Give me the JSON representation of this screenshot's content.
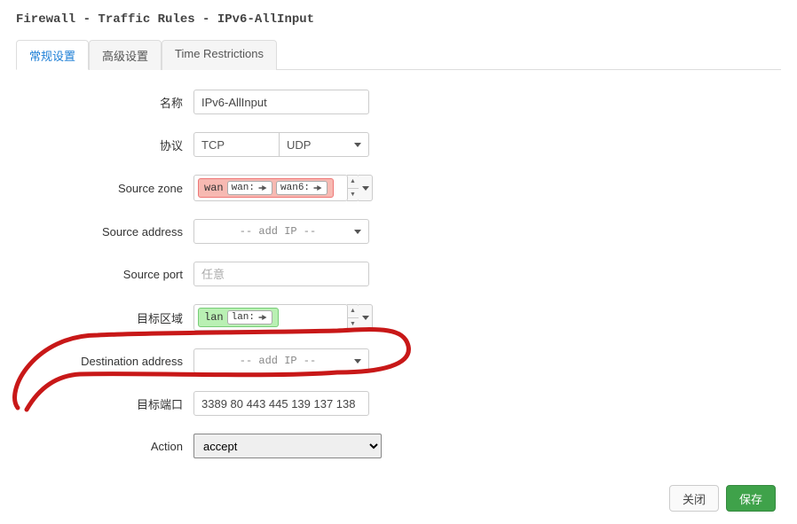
{
  "title": "Firewall - Traffic Rules - IPv6-AllInput",
  "tabs": {
    "items": [
      "常规设置",
      "高级设置",
      "Time Restrictions"
    ],
    "active_index": 0
  },
  "form": {
    "name": {
      "label": "名称",
      "value": "IPv6-AllInput"
    },
    "protocol": {
      "label": "协议",
      "left": "TCP",
      "right": "UDP"
    },
    "src_zone": {
      "label": "Source zone",
      "zone_label": "wan",
      "tags": [
        "wan:",
        "wan6:"
      ]
    },
    "src_addr": {
      "label": "Source address",
      "placeholder": "-- add IP --"
    },
    "src_port": {
      "label": "Source port",
      "placeholder": "任意",
      "value": ""
    },
    "dst_zone": {
      "label": "目标区域",
      "zone_label": "lan",
      "tags": [
        "lan:"
      ]
    },
    "dst_addr": {
      "label": "Destination address",
      "placeholder": "-- add IP --"
    },
    "dst_port": {
      "label": "目标端口",
      "value": "3389 80 443 445 139 137 138"
    },
    "action": {
      "label": "Action",
      "value": "accept"
    }
  },
  "footer": {
    "cancel": "关闭",
    "save": "保存"
  }
}
